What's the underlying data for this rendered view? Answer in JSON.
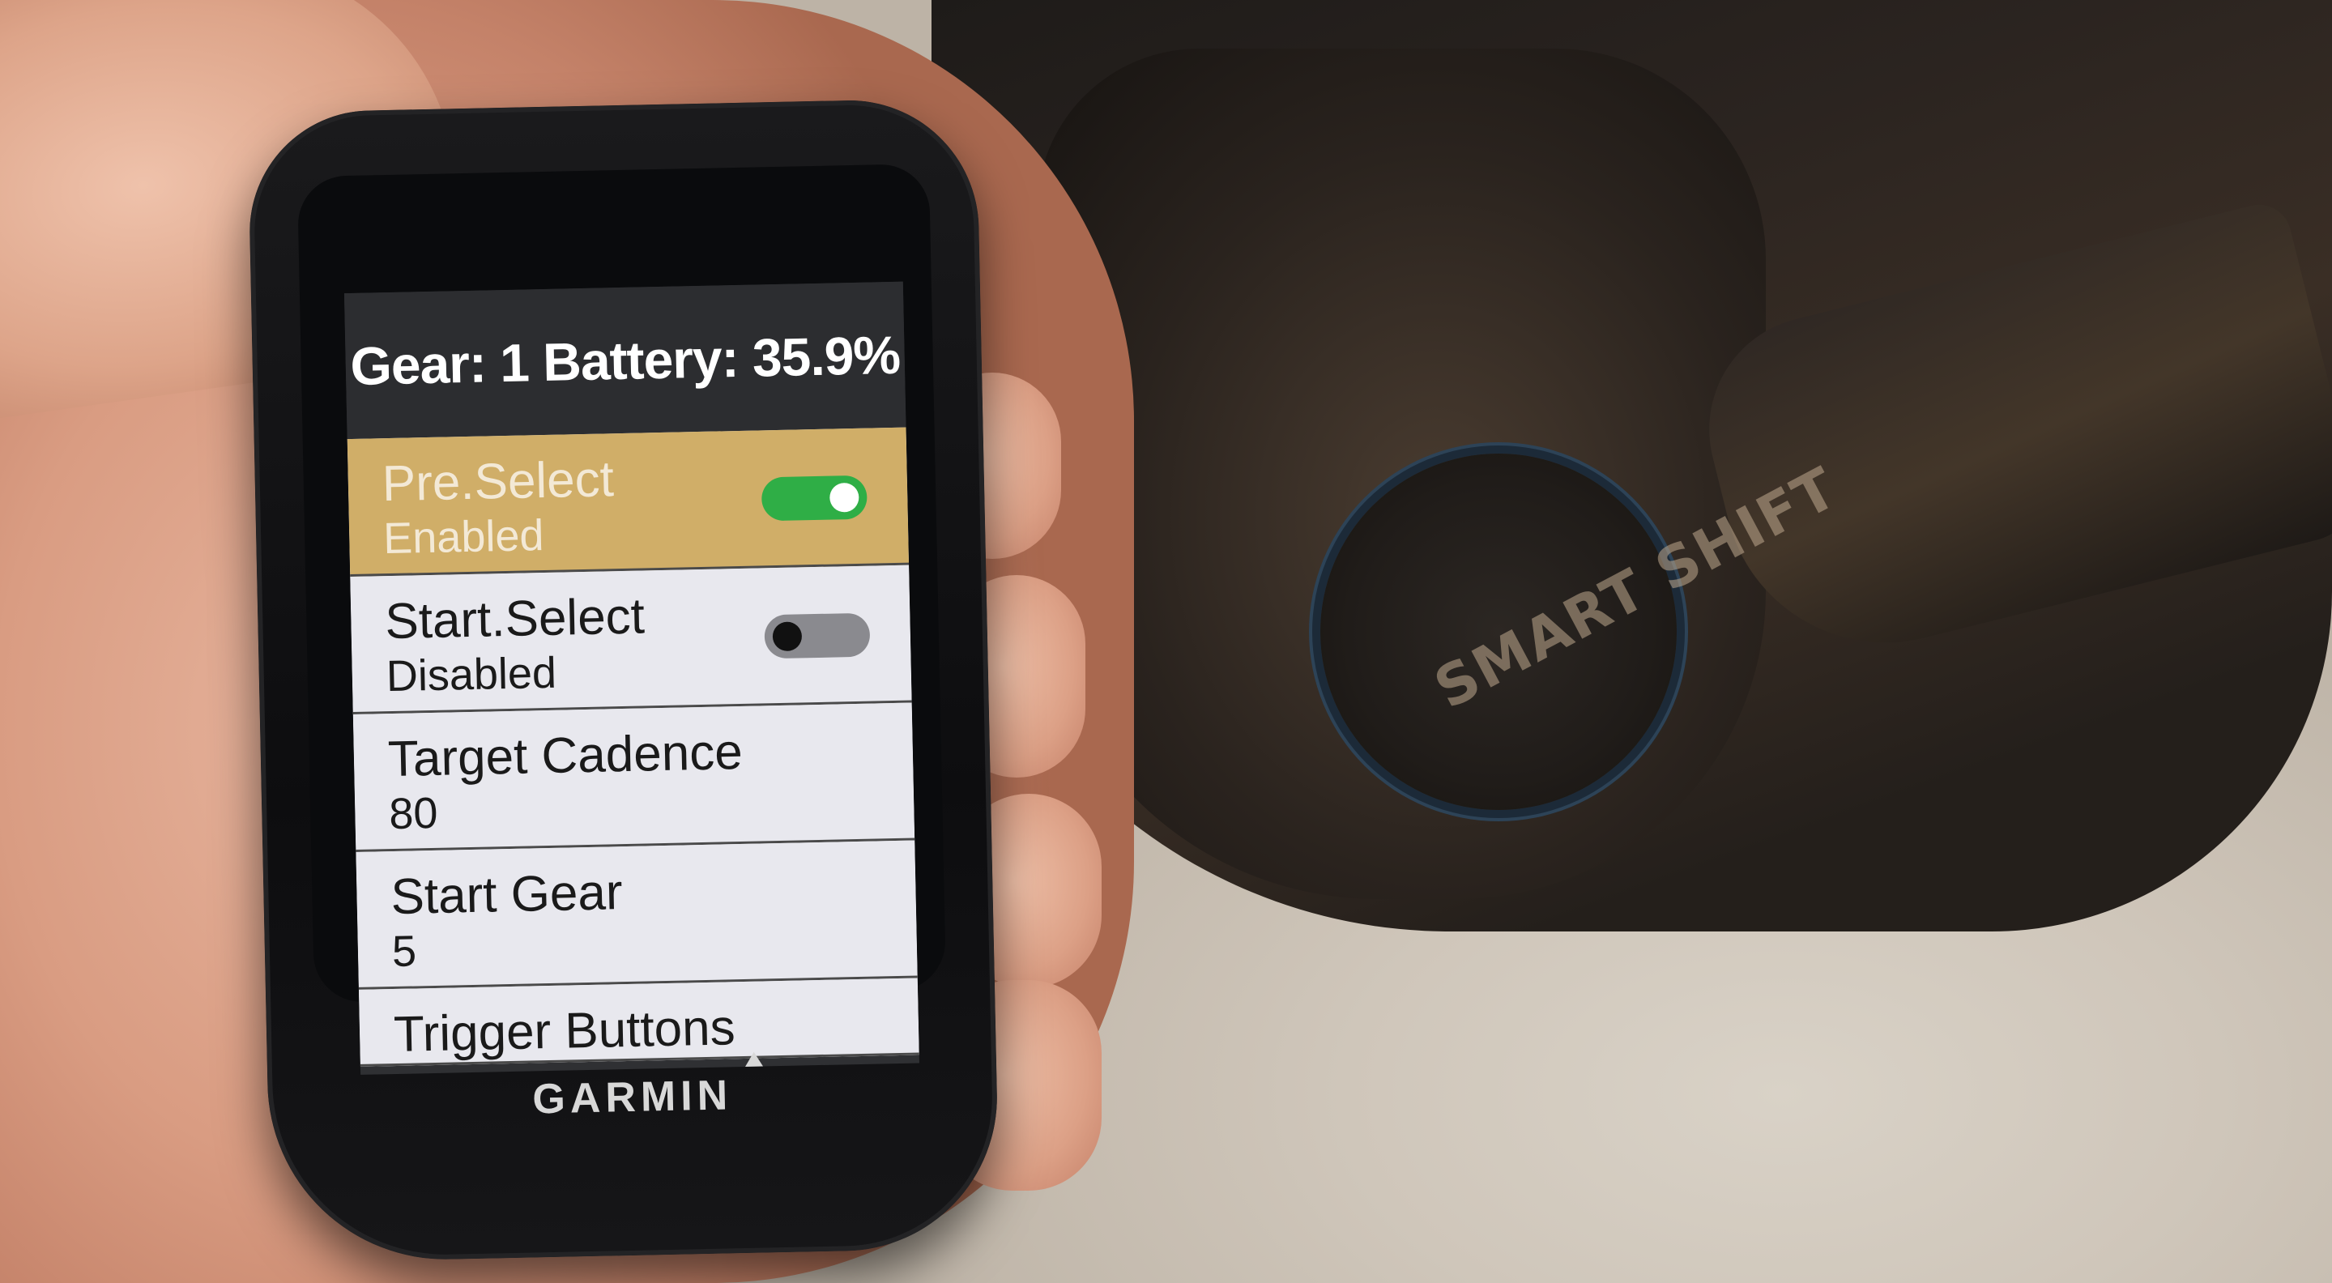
{
  "device": {
    "brand": "GARMIN"
  },
  "screen": {
    "status": "Gear: 1 Battery: 35.9%",
    "items": [
      {
        "label": "Pre.Select",
        "value": "Enabled",
        "toggle": "on",
        "selected": true
      },
      {
        "label": "Start.Select",
        "value": "Disabled",
        "toggle": "off",
        "selected": false
      },
      {
        "label": "Target Cadence",
        "value": "80"
      },
      {
        "label": "Start Gear",
        "value": "5"
      },
      {
        "label": "Trigger Buttons"
      }
    ]
  },
  "background": {
    "dial_text": "SMART SHIFT"
  },
  "colors": {
    "selected_row": "#d0ae68",
    "toggle_on": "#2fae46",
    "toggle_off": "#8a8a8f"
  }
}
